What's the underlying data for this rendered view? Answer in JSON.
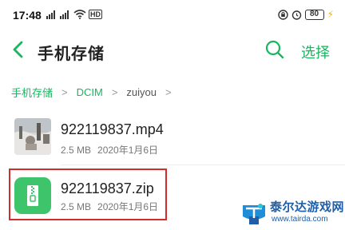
{
  "status_bar": {
    "time": "17:48",
    "signal_icons": [
      "signal-icon",
      "signal-icon",
      "wifi-icon",
      "hd-icon"
    ],
    "hd_label": "HD",
    "battery_level": "80",
    "right_icons": [
      "lock-rotation-icon",
      "alarm-icon",
      "battery-icon",
      "charging-icon"
    ]
  },
  "header": {
    "title": "手机存储",
    "select_label": "选择",
    "accent_color": "#19b55f"
  },
  "breadcrumb": {
    "items": [
      "手机存储",
      "DCIM",
      "zuiyou"
    ],
    "separator": ">"
  },
  "files": [
    {
      "name": "922119837.mp4",
      "size": "2.5 MB",
      "date": "2020年1月6日",
      "icon": "video-thumbnail"
    },
    {
      "name": "922119837.zip",
      "size": "2.5 MB",
      "date": "2020年1月6日",
      "icon": "zip-file-icon"
    }
  ],
  "highlight": {
    "color": "#d62b2b",
    "target": "922119837.zip"
  },
  "watermark": {
    "title": "泰尔达游戏网",
    "url": "www.tairda.com"
  }
}
